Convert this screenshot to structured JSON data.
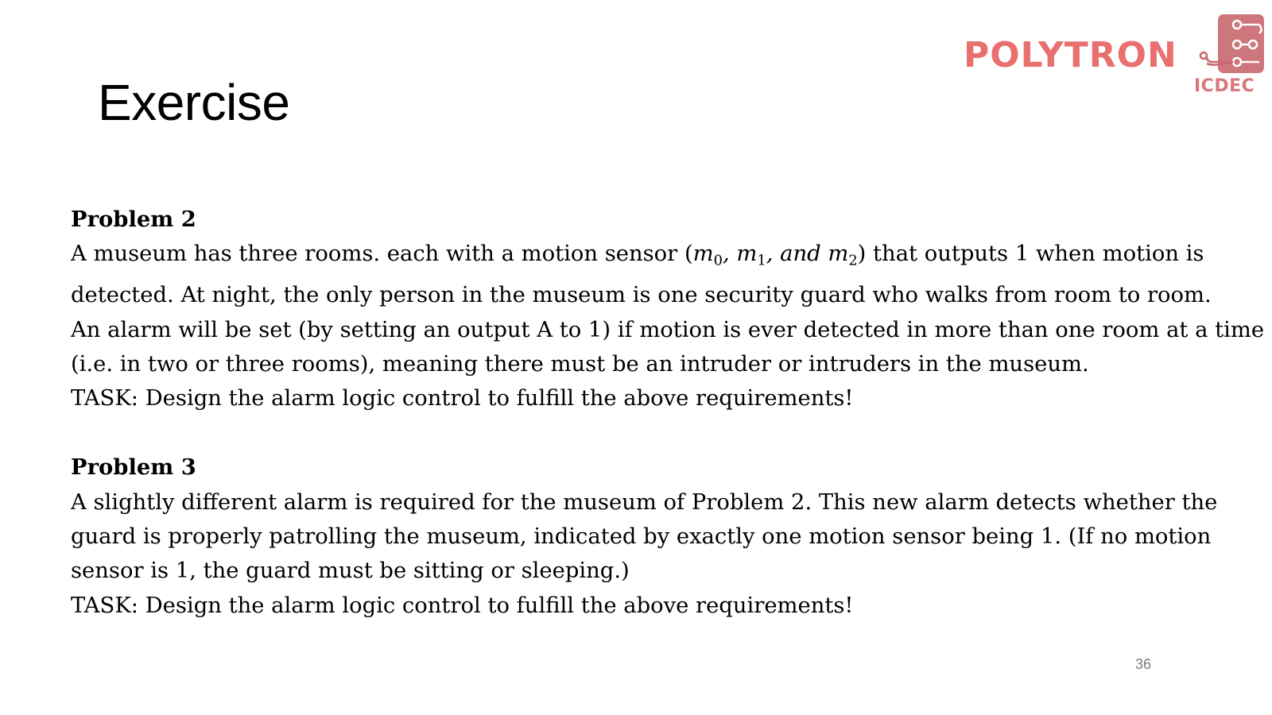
{
  "slide": {
    "title": "Exercise",
    "page_number": "36"
  },
  "logo": {
    "wordmark": "POLYTRON",
    "subtitle": "ICDEC",
    "icon": "circuit-trace-icon",
    "color": "#e8706f"
  },
  "problem2": {
    "heading": "Problem 2",
    "line1_before": "A museum has three rooms. each with a motion sensor (",
    "math_m": "m",
    "sub0": "0",
    "sub1": "1",
    "sub2": "2",
    "math_and": "and",
    "line1_after": ") that outputs 1 when motion is",
    "line2": "detected. At night, the only person in the museum is one security guard who walks from room to room.",
    "line3": "An alarm will be set (by setting an output A to 1) if motion is ever detected in more than one room at a time",
    "line4": "(i.e. in two or three rooms), meaning there must be an intruder or intruders in the museum.",
    "task": "TASK: Design the alarm logic control to fulfill the above requirements!"
  },
  "problem3": {
    "heading": "Problem 3",
    "line1": "A slightly different alarm is required for the museum of Problem 2. This new alarm detects whether the",
    "line2": "guard is properly patrolling the museum, indicated by exactly one motion sensor being 1. (If no motion",
    "line3": "sensor is 1, the guard must be sitting or sleeping.)",
    "task": "TASK: Design the alarm logic control to fulfill the above requirements!"
  }
}
